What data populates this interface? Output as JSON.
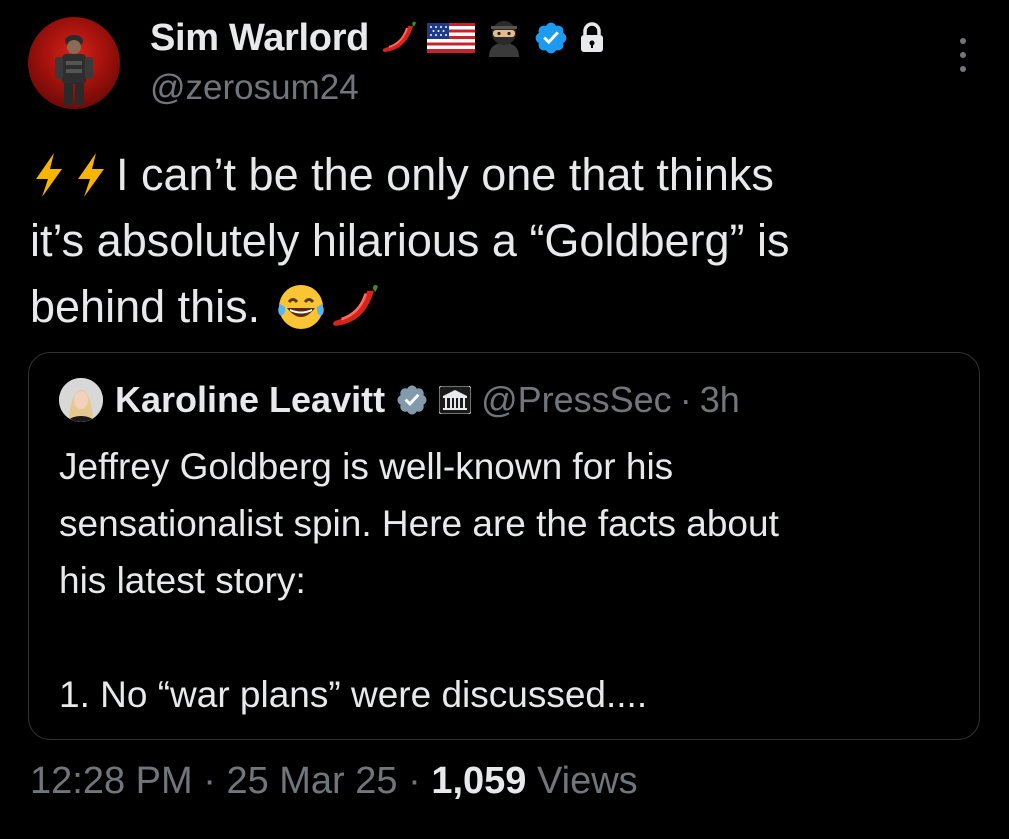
{
  "author": {
    "display_name": "Sim Warlord",
    "handle": "@zerosum24",
    "badges": [
      "chili-pepper-emoji",
      "us-flag-emoji",
      "ninja-emoji",
      "verified-badge-icon",
      "lock-icon"
    ]
  },
  "tweet": {
    "lines": [
      "I can’t be the only one that thinks",
      "it’s absolutely hilarious a “Goldberg” is",
      "behind this."
    ],
    "leading_emojis": [
      "high-voltage-emoji",
      "high-voltage-emoji"
    ],
    "trailing_emojis": [
      "tears-of-joy-emoji",
      "chili-pepper-emoji"
    ]
  },
  "quote": {
    "display_name": "Karoline Leavitt",
    "handle": "@PressSec",
    "time": "3h",
    "separator": "·",
    "lines": [
      "Jeffrey Goldberg is well-known for his",
      "sensationalist spin. Here are the facts about",
      "his latest story:",
      "",
      "1. No “war plans” were discussed...."
    ]
  },
  "meta": {
    "time": "12:28 PM",
    "date": "25 Mar 25",
    "views_count": "1,059",
    "views_label": "Views",
    "separator": "·"
  },
  "colors": {
    "background": "#000000",
    "text": "#e7e9ea",
    "muted": "#71767b",
    "verified_blue": "#1d9bf0",
    "border": "#2f3336"
  }
}
